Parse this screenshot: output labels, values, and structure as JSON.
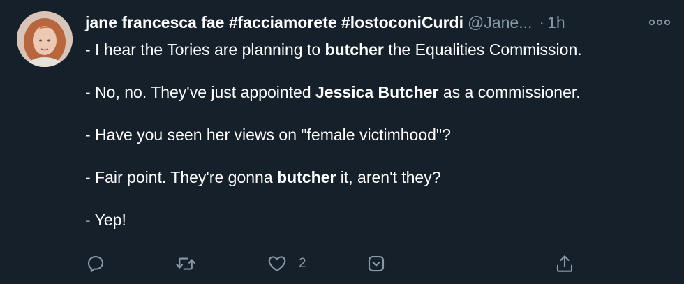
{
  "tweet": {
    "author": {
      "display_name": "jane francesca fae #facciamorete #lostoconiCurdi",
      "handle": "@Jane...",
      "separator": "·",
      "time": "1h"
    },
    "lines": [
      [
        {
          "text": "- I hear the Tories are planning to ",
          "bold": false
        },
        {
          "text": "butcher",
          "bold": true
        },
        {
          "text": " the Equalities Commission.",
          "bold": false
        }
      ],
      [
        {
          "text": "- No, no. They've just appointed ",
          "bold": false
        },
        {
          "text": "Jessica Butcher",
          "bold": true
        },
        {
          "text": " as a commissioner.",
          "bold": false
        }
      ],
      [
        {
          "text": "- Have you seen her views on \"female victimhood\"?",
          "bold": false
        }
      ],
      [
        {
          "text": "- Fair point. They're gonna ",
          "bold": false
        },
        {
          "text": "butcher",
          "bold": true
        },
        {
          "text": " it, aren't they?",
          "bold": false
        }
      ],
      [
        {
          "text": "- Yep!",
          "bold": false
        }
      ]
    ],
    "actions": {
      "reply_icon": "reply-icon",
      "retweet_icon": "retweet-icon",
      "like_icon": "heart-icon",
      "like_count": "2",
      "bookmark_icon": "bookmark-icon",
      "share_icon": "share-icon"
    },
    "colors": {
      "background": "#15202b",
      "text": "#ffffff",
      "secondary": "#8899a6"
    }
  }
}
